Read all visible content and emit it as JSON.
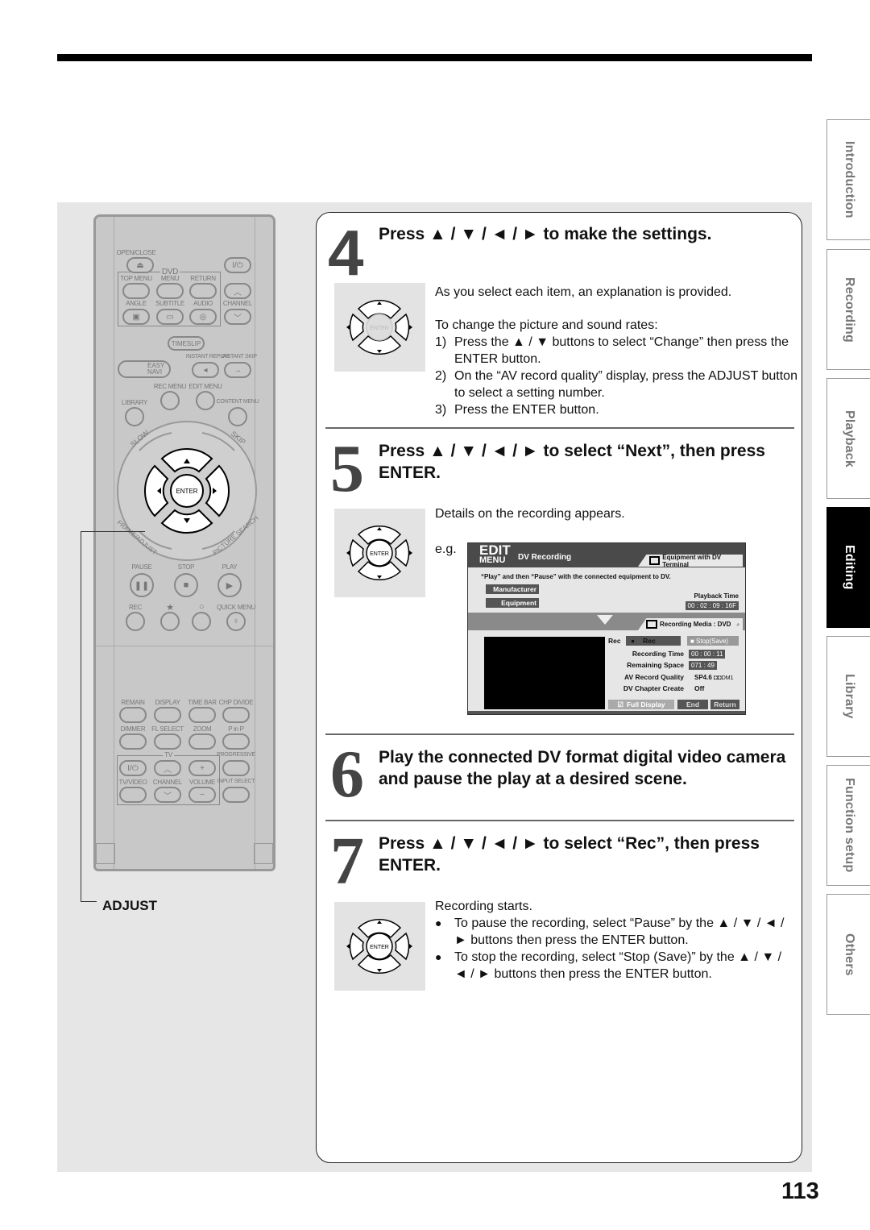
{
  "page_number": "113",
  "side_tabs": [
    {
      "label": "Introduction",
      "active": false
    },
    {
      "label": "Recording",
      "active": false
    },
    {
      "label": "Playback",
      "active": false
    },
    {
      "label": "Editing",
      "active": true
    },
    {
      "label": "Library",
      "active": false
    },
    {
      "label": "Function setup",
      "active": false
    },
    {
      "label": "Others",
      "active": false
    }
  ],
  "remote": {
    "open_close": "OPEN/CLOSE",
    "dvd": "DVD",
    "top_menu": "TOP MENU",
    "menu": "MENU",
    "return": "RETURN",
    "angle": "ANGLE",
    "subtitle": "SUBTITLE",
    "audio": "AUDIO",
    "channel": "CHANNEL",
    "timeslip": "TIMESLIP",
    "easy_navi": "EASY NAVI",
    "instant_replay": "INSTANT REPLAY",
    "instant_skip": "INSTANT SKIP",
    "rec_menu": "REC MENU",
    "edit_menu": "EDIT MENU",
    "library": "LIBRARY",
    "content_menu": "CONTENT MENU",
    "slow": "SLOW",
    "skip": "SKIP",
    "enter": "ENTER",
    "frame_adjust": "FRAME/ADJUST",
    "picture_search": "PICTURE SEARCH",
    "pause": "PAUSE",
    "stop": "STOP",
    "play": "PLAY",
    "rec": "REC",
    "star": "★",
    "circle": "○",
    "quick_menu": "QUICK MENU",
    "remain": "REMAIN",
    "display": "DISPLAY",
    "time_bar": "TIME BAR",
    "chp_divide": "CHP DIVIDE",
    "dimmer": "DIMMER",
    "fl_select": "FL SELECT",
    "zoom": "ZOOM",
    "p_in_p": "P in P",
    "tv": "TV",
    "progressive": "PROGRESSIVE",
    "tv_video": "TV/VIDEO",
    "tv_channel": "CHANNEL",
    "volume": "VOLUME",
    "input_select": "INPUT SELECT",
    "power_glyph": "I/⏻"
  },
  "callout": {
    "adjust": "ADJUST"
  },
  "steps": [
    {
      "number": "4",
      "title": "Press ▲ / ▼ / ◄ / ► to make the settings.",
      "intro": "As you select each item, an explanation is provided.",
      "sub_intro": "To change the picture and sound rates:",
      "items": [
        {
          "n": "1)",
          "text": "Press the ▲ / ▼ buttons to select “Change” then press the ENTER button."
        },
        {
          "n": "2)",
          "text": "On the  “AV record quality” display, press the ADJUST button to select a setting number."
        },
        {
          "n": "3)",
          "text": "Press the ENTER button."
        }
      ]
    },
    {
      "number": "5",
      "title": "Press ▲ / ▼ / ◄ / ► to select “Next”, then press ENTER.",
      "intro": "Details on the recording appears.",
      "eg": "e.g."
    },
    {
      "number": "6",
      "title": "Play the connected DV format digital video camera and pause the play at a desired scene."
    },
    {
      "number": "7",
      "title": "Press ▲ / ▼ / ◄ / ► to select “Rec”, then press ENTER.",
      "intro": "Recording starts.",
      "bullets": [
        {
          "n": "●",
          "text": "To pause the recording, select “Pause” by the ▲ / ▼ / ◄ / ► buttons then press the ENTER button."
        },
        {
          "n": "●",
          "text": "To stop the recording, select “Stop (Save)” by the ▲ / ▼ / ◄ / ► buttons then press the ENTER button."
        }
      ]
    }
  ],
  "osd": {
    "edit": "EDIT",
    "menu": "MENU",
    "title": "DV Recording",
    "equipment_tab": "Equipment with DV Terminal",
    "instruction": "“Play” and then “Pause” with the connected equipment to DV.",
    "manufacturer": "Manufacturer",
    "equipment": "Equipment",
    "playback_time_label": "Playback Time",
    "playback_time": "00 : 02 : 09 : 16F",
    "recording_media": "Recording Media : DVD",
    "rec_label": "Rec",
    "rec_button": "Rec",
    "stop_button": "■ Stop(Save)",
    "recording_time_label": "Recording Time",
    "recording_time": "00 : 00 : 11",
    "remaining_space_label": "Remaining Space",
    "remaining_space": "071 : 49",
    "av_quality_label": "AV Record Quality",
    "av_quality": "SP4.6",
    "av_audio": "DM1",
    "chapter_label": "DV Chapter Create",
    "chapter_value": "Off",
    "full_display": "Full Display",
    "end": "End",
    "return": "Return"
  }
}
